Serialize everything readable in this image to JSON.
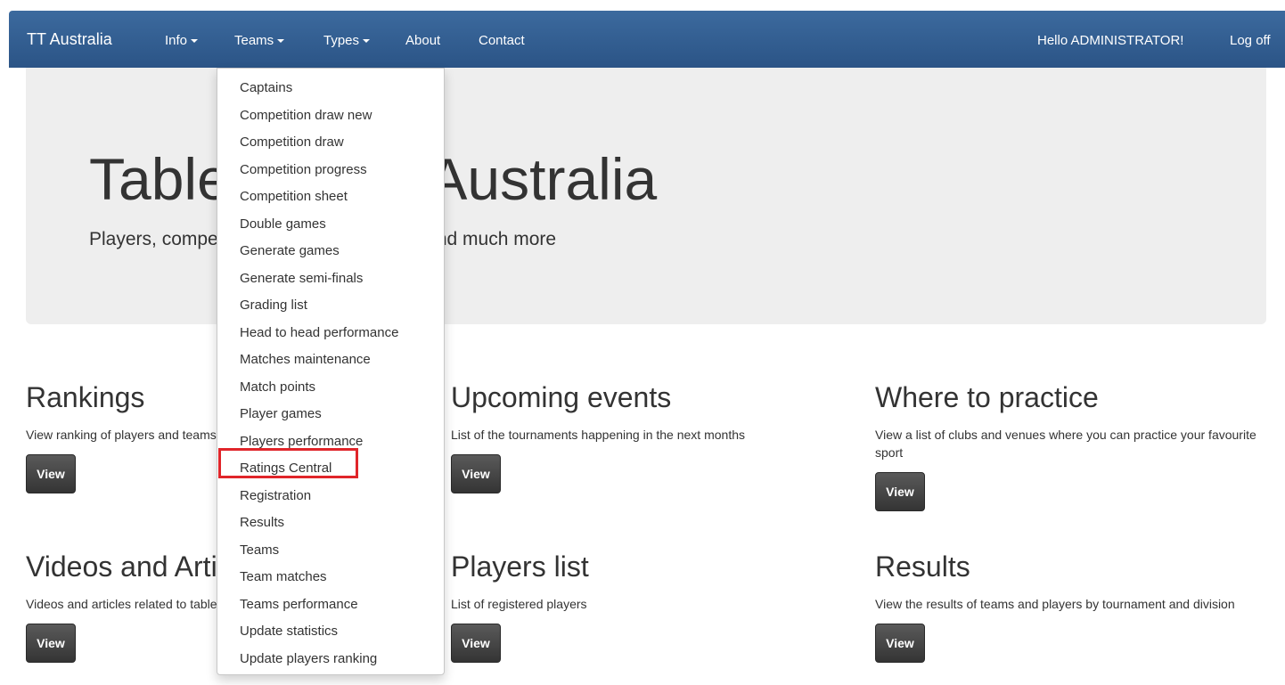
{
  "navbar": {
    "brand": "TT Australia",
    "items": [
      {
        "label": "Info",
        "dropdown": true
      },
      {
        "label": "Teams",
        "dropdown": true
      },
      {
        "label": "Types",
        "dropdown": true
      },
      {
        "label": "About",
        "dropdown": false
      },
      {
        "label": "Contact",
        "dropdown": false
      }
    ],
    "greeting": "Hello ADMINISTRATOR!",
    "logoff": "Log off"
  },
  "jumbotron": {
    "title": "Table Tennis Australia",
    "subtitle": "Players, competitions, ranking, statistics and much more"
  },
  "sections": [
    {
      "title": "Rankings",
      "text": "View ranking of players and teams",
      "button": "View"
    },
    {
      "title": "Upcoming events",
      "text": "List of the tournaments happening in the next months",
      "button": "View"
    },
    {
      "title": "Where to practice",
      "text": "View a list of clubs and venues where you can practice your favourite sport",
      "button": "View"
    },
    {
      "title": "Videos and Articles",
      "text": "Videos and articles related to table tennis in Australia and World",
      "button": "View"
    },
    {
      "title": "Players list",
      "text": "List of registered players",
      "button": "View"
    },
    {
      "title": "Results",
      "text": "View the results of teams and players by tournament and division",
      "button": "View"
    }
  ],
  "teams_menu": {
    "items": [
      "Captains",
      "Competition draw new",
      "Competition draw",
      "Competition progress",
      "Competition sheet",
      "Double games",
      "Generate games",
      "Generate semi-finals",
      "Grading list",
      "Head to head performance",
      "Matches maintenance",
      "Match points",
      "Player games",
      "Players performance",
      "Ratings Central",
      "Registration",
      "Results",
      "Teams",
      "Team matches",
      "Teams performance",
      "Update statistics",
      "Update players ranking"
    ],
    "highlighted": "Ratings Central"
  },
  "colors": {
    "navbar": "#2f5b8f",
    "jumbotron": "#eeeeee",
    "button": "#3f3f3f",
    "highlight": "#e0252a"
  }
}
